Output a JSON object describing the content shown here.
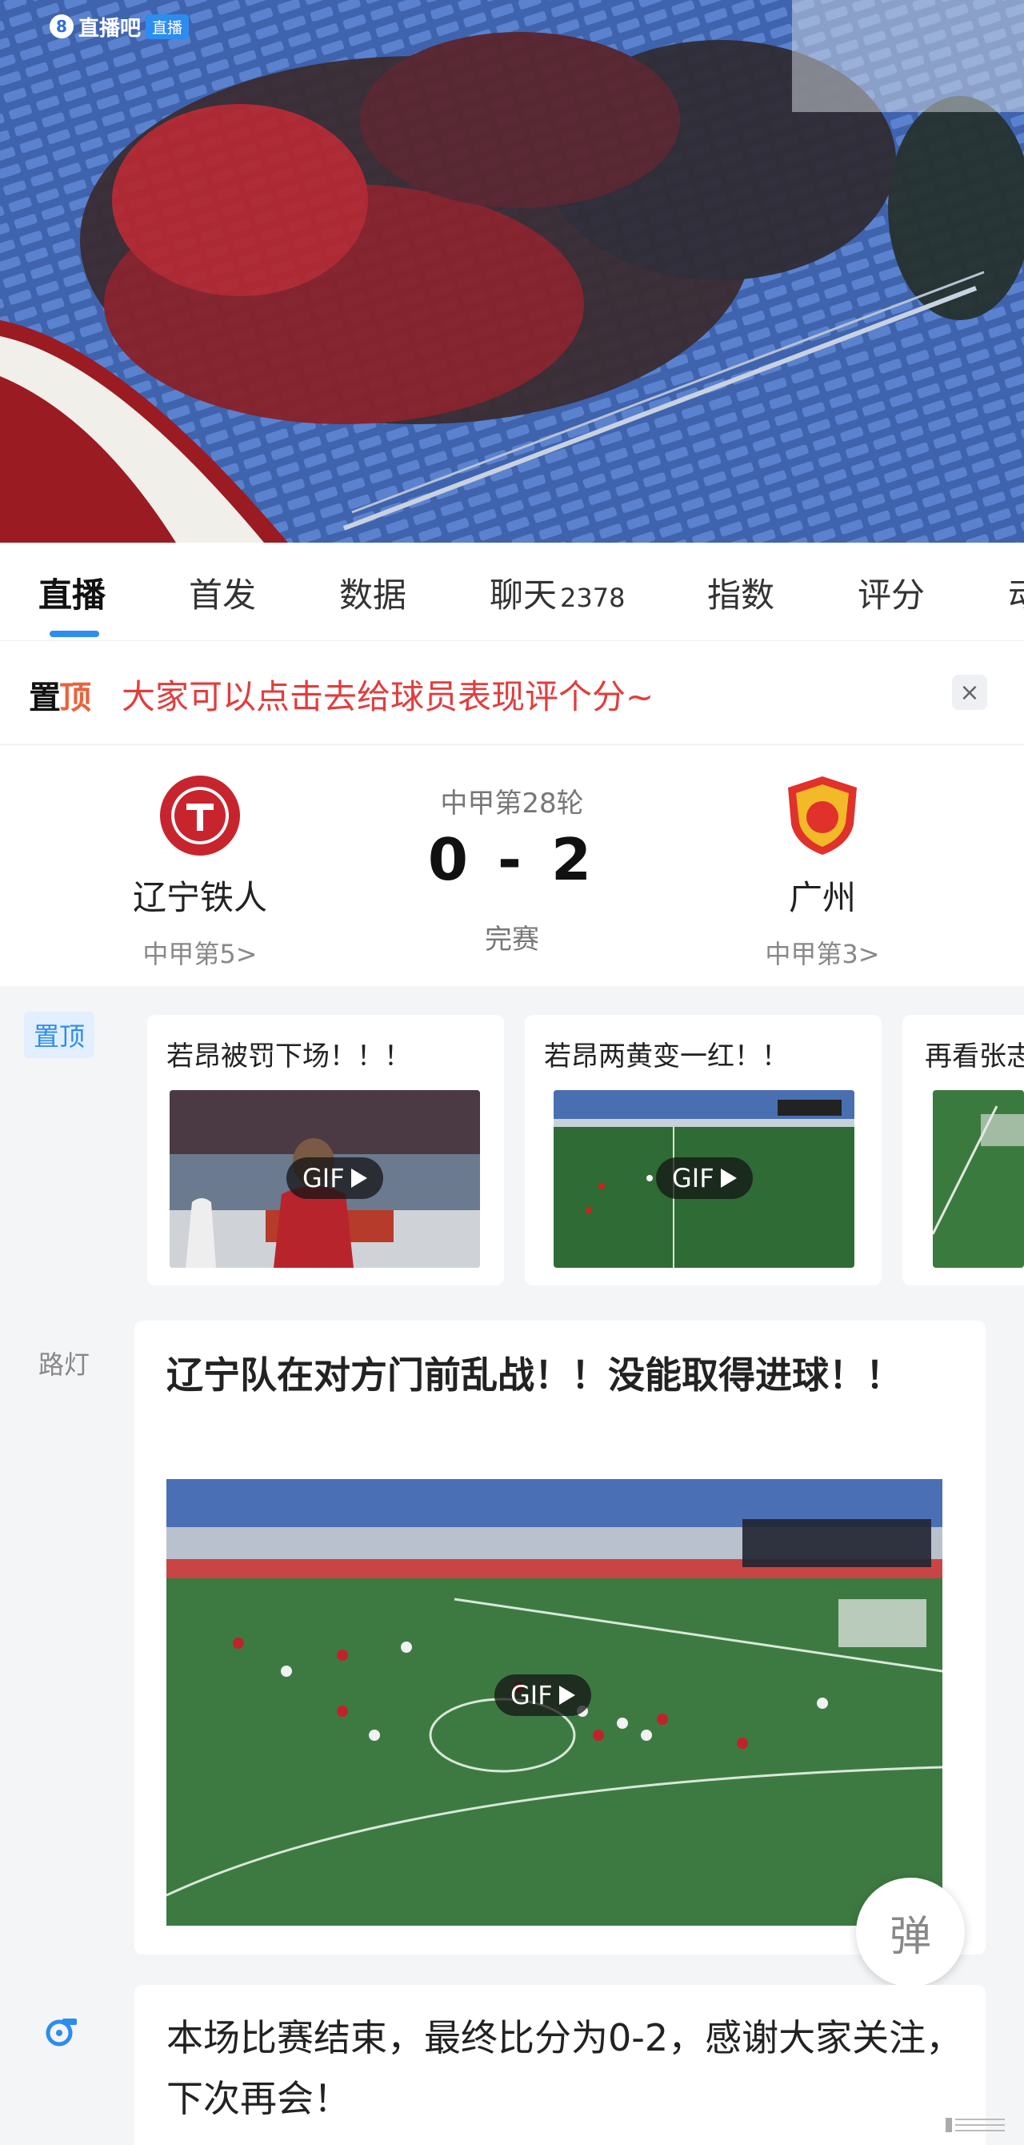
{
  "hero": {
    "app_name": "直播吧",
    "live_label": "直播",
    "logo_glyph": "8"
  },
  "tabs": [
    {
      "label": "直播",
      "active": true
    },
    {
      "label": "首发"
    },
    {
      "label": "数据"
    },
    {
      "label": "聊天",
      "count": "2378"
    },
    {
      "label": "指数"
    },
    {
      "label": "评分"
    },
    {
      "label": "动"
    }
  ],
  "pinned": {
    "logo_main": "置",
    "logo_accent": "顶",
    "text": "大家可以点击去给球员表现评个分~",
    "close_glyph": "×"
  },
  "match": {
    "round": "中甲第28轮",
    "score": "0 - 2",
    "status": "完赛",
    "home": {
      "name": "辽宁铁人",
      "rank": "中甲第5>",
      "color": "#c8242e"
    },
    "away": {
      "name": "广州",
      "rank": "中甲第3>",
      "color": "#e0312b"
    }
  },
  "highlights": {
    "tag": "置顶",
    "gif_label": "GIF",
    "items": [
      {
        "title": "若昂被罚下场！！！"
      },
      {
        "title": "若昂两黄变一红！！"
      },
      {
        "title": "再看张志"
      }
    ]
  },
  "post": {
    "tag": "路灯",
    "title": "辽宁队在对方门前乱战！！没能取得进球！！",
    "gif_label": "GIF"
  },
  "danmu_label": "弹",
  "final": {
    "text": "本场比赛结束，最终比分为0-2，感谢大家关注，下次再会！"
  },
  "colors": {
    "accent": "#2c8cf0",
    "pinned_text": "#e23d3d"
  }
}
